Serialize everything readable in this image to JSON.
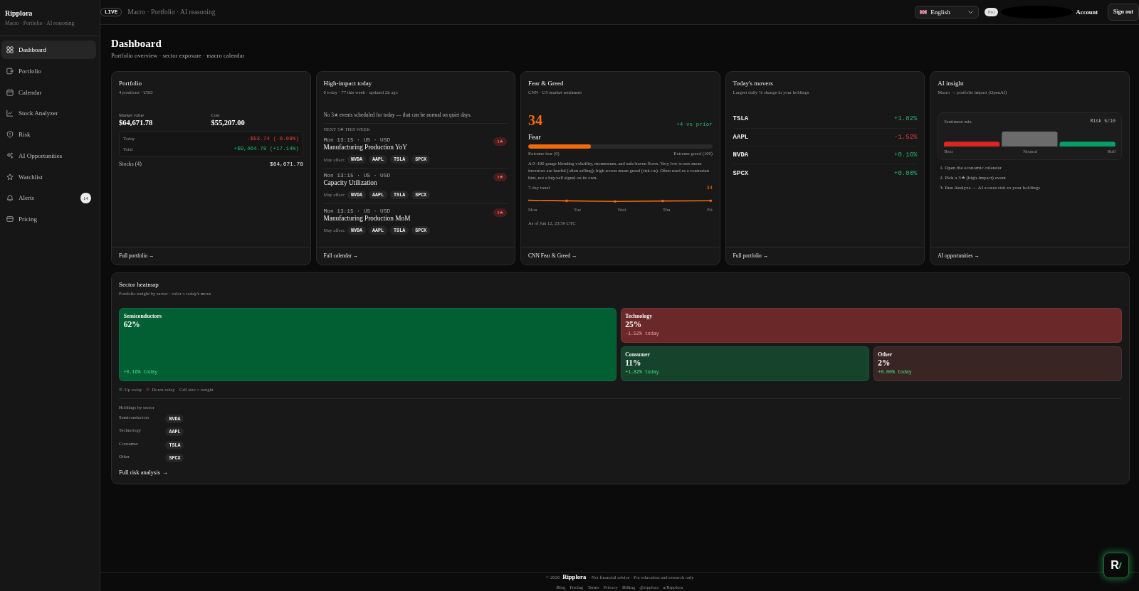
{
  "sidebar": {
    "brand": "Ripplora",
    "tagline": "Macro · Portfolio · AI reasoning",
    "items": [
      {
        "label": "Dashboard",
        "selected": true
      },
      {
        "label": "Portfolio",
        "selected": false
      },
      {
        "label": "Calendar",
        "selected": false
      },
      {
        "label": "Stock Analyzer",
        "selected": false
      },
      {
        "label": "Risk",
        "selected": false
      },
      {
        "label": "AI Opportunities",
        "selected": false
      },
      {
        "label": "Watchlist",
        "selected": false
      },
      {
        "label": "Alerts",
        "selected": false,
        "badge": "14"
      },
      {
        "label": "Pricing",
        "selected": false
      }
    ]
  },
  "header": {
    "live_badge": "LIVE",
    "tagline": "Macro · Portfolio · AI reasoning",
    "language": "English",
    "plan_badge": "Pro",
    "account_link": "Account",
    "sign_out": "Sign out"
  },
  "page": {
    "title": "Dashboard",
    "subtitle": "Portfolio overview · sector exposure · macro calendar"
  },
  "portfolio": {
    "title": "Portfolio",
    "subtitle": "4 positions · USD",
    "stats": [
      {
        "label": "Market value",
        "value": "$64,671.78"
      },
      {
        "label": "Cost",
        "value": "$55,207.00"
      }
    ],
    "pnl": [
      {
        "label": "Today",
        "value": "-$53.74 (-0.08%)",
        "down": true
      },
      {
        "label": "Total",
        "value": "+$9,464.78 (+17.14%)",
        "down": false
      }
    ],
    "holdings_label": "Stocks (4)",
    "holdings_value": "$64,671.78",
    "footer_link": "Full portfolio →"
  },
  "high_impact": {
    "title": "High-impact today",
    "subtitle": "0 today · 77 this week · updated 2h ago",
    "empty_message": "No 3★ events scheduled for today — that can be normal on quiet days.",
    "section_label": "NEXT 3★ THIS WEEK",
    "events": [
      {
        "time": "Mon 13:15 · US · USD",
        "name": "Manufacturing Production YoY",
        "impact": "3★",
        "affects_label": "May affect:",
        "tickers": [
          "NVDA",
          "AAPL",
          "TSLA",
          "SPCX"
        ]
      },
      {
        "time": "Mon 13:15 · US · USD",
        "name": "Capacity Utilization",
        "impact": "3★",
        "affects_label": "May affect:",
        "tickers": [
          "NVDA",
          "AAPL",
          "TSLA",
          "SPCX"
        ]
      },
      {
        "time": "Mon 13:15 · US · USD",
        "name": "Manufacturing Production MoM",
        "impact": "3★",
        "affects_label": "May affect:",
        "tickers": [
          "NVDA",
          "AAPL",
          "TSLA",
          "SPCX"
        ]
      }
    ],
    "footer_link": "Full calendar →"
  },
  "fear_greed": {
    "title": "Fear & Greed",
    "subtitle": "CNN · US market sentiment",
    "score": "34",
    "change": "+4 vs prior",
    "sentiment": "Fear",
    "level": 0.34,
    "scale_min": "Extreme fear (0)",
    "scale_max": "Extreme greed (100)",
    "description": "A 0–100 gauge blending volatility, momentum, and safe-haven flows. Very low scores mean investors are fearful (often selling); high scores mean greed (risk-on). Often used as a contrarian hint, not a buy/sell signal on its own.",
    "trend_label": "7-day trend",
    "trend_value": "34",
    "trend_days": [
      "Mon",
      "Tue",
      "Wed",
      "Thu",
      "Fri"
    ],
    "as_of": "As of Jun 12, 23:59 UTC",
    "footer_link": "CNN Fear & Greed →"
  },
  "movers": {
    "title": "Today's movers",
    "subtitle": "Largest daily % change in your holdings",
    "rows": [
      {
        "ticker": "TSLA",
        "change": "+1.82%",
        "down": false
      },
      {
        "ticker": "AAPL",
        "change": "-1.52%",
        "down": true
      },
      {
        "ticker": "NVDA",
        "change": "+0.16%",
        "down": false
      },
      {
        "ticker": "SPCX",
        "change": "+0.00%",
        "down": false
      }
    ],
    "footer_link": "Full portfolio →"
  },
  "ai_insight": {
    "title": "AI insight",
    "subtitle": "Macro → portfolio impact (OpenAI)",
    "mix_label": "Sentiment mix",
    "risk": "Risk 5/10",
    "bar_labels": [
      "Bear",
      "Neutral",
      "Bull"
    ],
    "steps": [
      "1. Open the economic calendar",
      "2. Pick a 3★ (high-impact) event",
      "3. Run Analyze — AI scores risk vs your holdings"
    ],
    "footer_link": "AI opportunities →"
  },
  "heatmap": {
    "title": "Sector heatmap",
    "subtitle": "Portfolio weight by sector · color = today's move",
    "sectors": [
      {
        "name": "Semiconductors",
        "weight": "62%",
        "change": "+0.16% today",
        "down": false,
        "color": "#025e33"
      },
      {
        "name": "Technology",
        "weight": "25%",
        "change": "-1.52% today",
        "down": true,
        "color": "#6b2828"
      },
      {
        "name": "Consumer",
        "weight": "11%",
        "change": "+1.82% today",
        "down": false,
        "color": "#15432c"
      },
      {
        "name": "Other",
        "weight": "2%",
        "change": "+0.00% today",
        "down": false,
        "color": "#3a2525"
      }
    ],
    "legend": [
      {
        "label": "Up today",
        "color": "#1f4d33"
      },
      {
        "label": "Down today",
        "color": "#4d2626"
      }
    ],
    "legend_note": "Cell size = weight",
    "holdings_title": "Holdings by sector",
    "holdings": [
      {
        "sector": "Semiconductors",
        "tickers": [
          "NVDA"
        ]
      },
      {
        "sector": "Technology",
        "tickers": [
          "AAPL"
        ]
      },
      {
        "sector": "Consumer",
        "tickers": [
          "TSLA"
        ]
      },
      {
        "sector": "Other",
        "tickers": [
          "SPCX"
        ]
      }
    ],
    "footer_link": "Full risk analysis →"
  },
  "footer": {
    "copyright": "© 2026",
    "brand": "Ripplora",
    "note": "· Not financial advice · For education and research only",
    "links": [
      "Blog",
      "Pricing",
      "Terms",
      "Privacy",
      "Billing",
      "@ripplora",
      "u/Ripplora"
    ]
  },
  "assistant_button": {
    "label": "R"
  }
}
